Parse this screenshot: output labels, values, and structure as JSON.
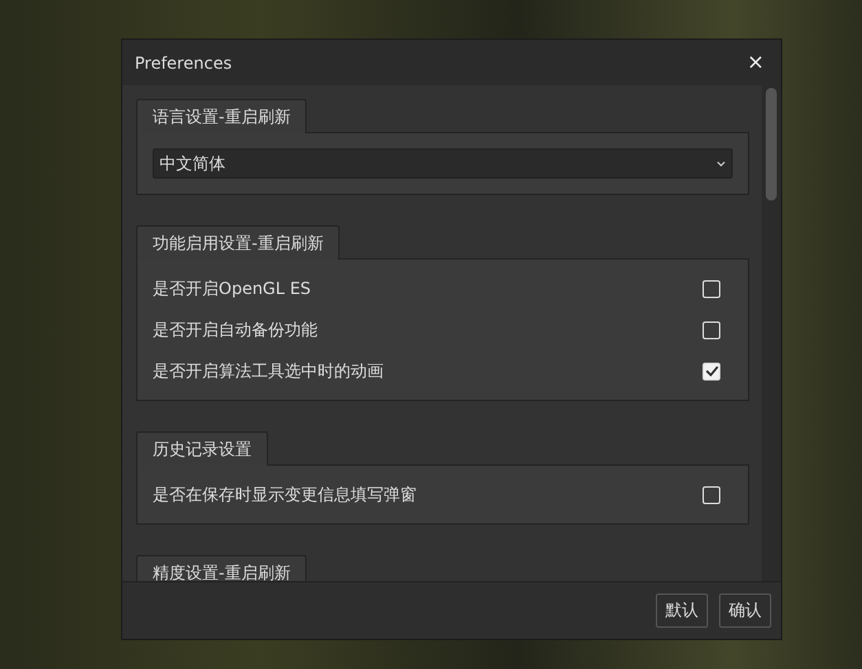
{
  "window": {
    "title": "Preferences",
    "close": "×"
  },
  "sections": [
    {
      "title": "语言设置-重启刷新",
      "kind": "dropdown",
      "dropdown": {
        "value": "中文简体"
      }
    },
    {
      "title": "功能启用设置-重启刷新",
      "kind": "checkboxes",
      "options": [
        {
          "label": "是否开启OpenGL ES",
          "checked": false
        },
        {
          "label": "是否开启自动备份功能",
          "checked": false
        },
        {
          "label": "是否开启算法工具选中时的动画",
          "checked": true
        }
      ]
    },
    {
      "title": "历史记录设置",
      "kind": "checkboxes",
      "options": [
        {
          "label": "是否在保存时显示变更信息填写弹窗",
          "checked": false
        }
      ]
    },
    {
      "title": "精度设置-重启刷新",
      "kind": "checkboxes"
    }
  ],
  "buttons": [
    "默认",
    "确认"
  ]
}
